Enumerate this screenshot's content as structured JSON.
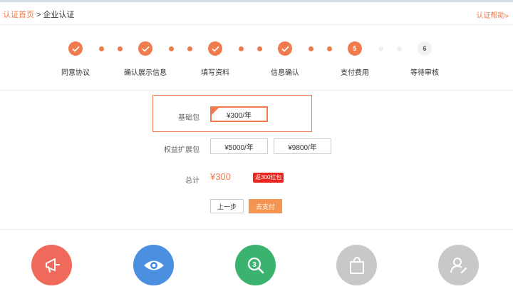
{
  "header": {
    "home": "认证首页",
    "separator": ">",
    "current": "企业认证",
    "help": "认证帮助»"
  },
  "steps": [
    {
      "label": "同意协议",
      "state": "done"
    },
    {
      "label": "确认展示信息",
      "state": "done"
    },
    {
      "label": "填写资料",
      "state": "done"
    },
    {
      "label": "信息确认",
      "state": "done"
    },
    {
      "label": "支付费用",
      "state": "active",
      "number": "5"
    },
    {
      "label": "等待审核",
      "state": "pending",
      "number": "6"
    }
  ],
  "form": {
    "basic_label": "基础包",
    "basic_option": "¥300/年",
    "ext_label": "权益扩展包",
    "ext_options": [
      "¥5000/年",
      "¥9800/年"
    ],
    "total_label": "总计",
    "total_value": "¥300",
    "coupon_badge": "返300红包",
    "prev_button": "上一步",
    "pay_button": "去支付"
  },
  "features": [
    {
      "icon": "megaphone-icon",
      "color": "#ef6a5a"
    },
    {
      "icon": "eye-icon",
      "color": "#4a8fe0"
    },
    {
      "icon": "search-number-icon",
      "color": "#3bb36f"
    },
    {
      "icon": "shopping-bag-icon",
      "color": "#c8c8c8"
    },
    {
      "icon": "user-edit-icon",
      "color": "#c8c8c8"
    }
  ],
  "colors": {
    "accent": "#f07c4d",
    "badge": "#e8251e"
  }
}
